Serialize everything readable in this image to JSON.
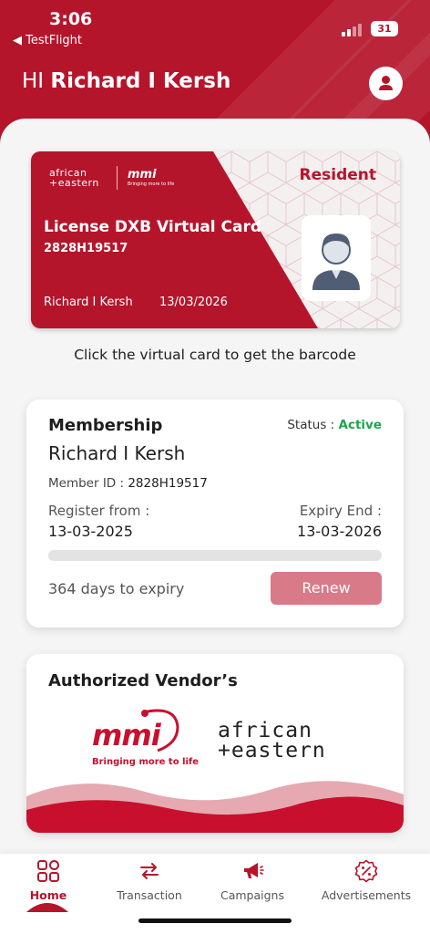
{
  "status_bar": {
    "time": "3:06",
    "back_label": "◀ TestFlight",
    "battery": "31"
  },
  "header": {
    "greeting_prefix": "HI",
    "user_name": "Richard I Kersh"
  },
  "virtual_card": {
    "brand_left_line1": "african",
    "brand_left_line2": "+eastern",
    "brand_right": "mmi",
    "brand_right_tagline": "Bringing more to life",
    "type_label": "Resident",
    "title": "License DXB Virtual Card",
    "number": "2828H19517",
    "holder_name": "Richard I Kersh",
    "expiry": "13/03/2026"
  },
  "hint": "Click the virtual card to get the barcode",
  "membership": {
    "title": "Membership",
    "status_label": "Status :",
    "status_value": "Active",
    "name": "Richard I Kersh",
    "member_id_label": "Member ID :",
    "member_id": "2828H19517",
    "register_label": "Register from :",
    "register_date": "13-03-2025",
    "expiry_label": "Expiry End :",
    "expiry_date": "13-03-2026",
    "progress_fraction": 0.0,
    "days_to_expiry": "364 days to expiry",
    "renew_label": "Renew"
  },
  "vendors": {
    "title": "Authorized Vendor’s",
    "mmi": {
      "word": "mmi",
      "tagline": "Bringing more to life"
    },
    "african_eastern": {
      "line1": "african",
      "line2": "+eastern"
    }
  },
  "nav": {
    "items": [
      {
        "label": "Home",
        "icon": "grid-icon",
        "active": true
      },
      {
        "label": "Transaction",
        "icon": "swap-arrows-icon",
        "active": false
      },
      {
        "label": "Campaigns",
        "icon": "megaphone-icon",
        "active": false
      },
      {
        "label": "Advertisements",
        "icon": "discount-badge-icon",
        "active": false
      }
    ]
  },
  "colors": {
    "brand_red": "#b5152b",
    "renew": "#d87a87",
    "active_green": "#1ba64a"
  }
}
